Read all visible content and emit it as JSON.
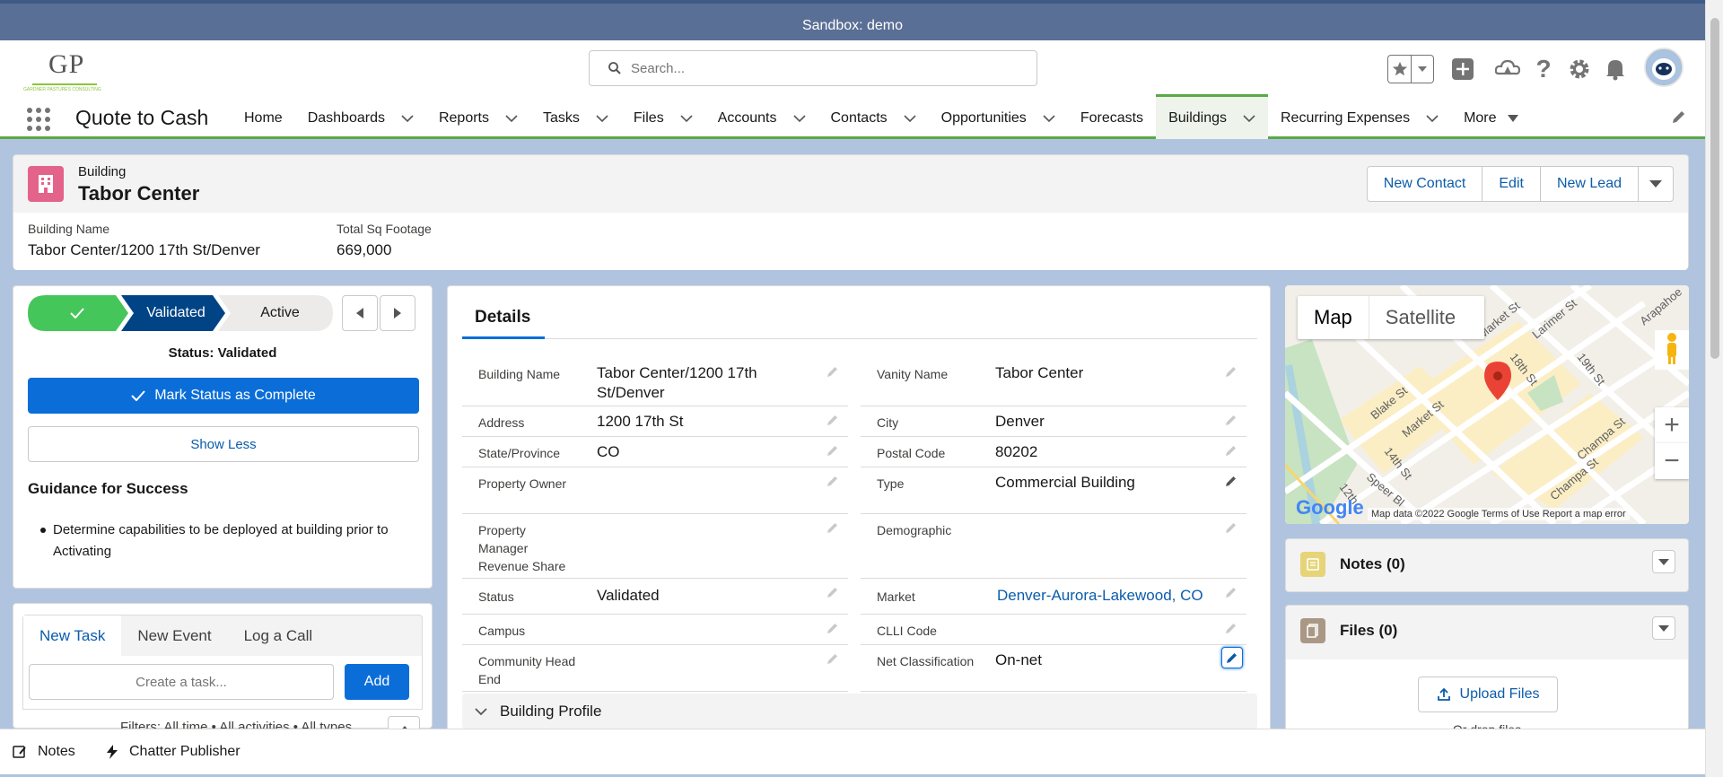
{
  "sandbox": {
    "label": "Sandbox: demo"
  },
  "logo": {
    "letters": "GP",
    "tagline": "GARDNER PASTURES CONSULTING"
  },
  "search": {
    "placeholder": "Search..."
  },
  "app": {
    "name": "Quote to Cash"
  },
  "nav": {
    "items": [
      {
        "label": "Home",
        "has_menu": false
      },
      {
        "label": "Dashboards",
        "has_menu": true
      },
      {
        "label": "Reports",
        "has_menu": true
      },
      {
        "label": "Tasks",
        "has_menu": true
      },
      {
        "label": "Files",
        "has_menu": true
      },
      {
        "label": "Accounts",
        "has_menu": true
      },
      {
        "label": "Contacts",
        "has_menu": true
      },
      {
        "label": "Opportunities",
        "has_menu": true
      },
      {
        "label": "Forecasts",
        "has_menu": false
      },
      {
        "label": "Buildings",
        "has_menu": true,
        "active": true
      },
      {
        "label": "Recurring Expenses",
        "has_menu": true
      },
      {
        "label": "More",
        "has_menu": true
      }
    ]
  },
  "record": {
    "type": "Building",
    "title": "Tabor Center",
    "actions": {
      "new_contact": "New Contact",
      "edit": "Edit",
      "new_lead": "New Lead"
    },
    "highlights": [
      {
        "label": "Building Name",
        "value": "Tabor Center/1200 17th St/Denver"
      },
      {
        "label": "Total Sq Footage",
        "value": "669,000"
      }
    ]
  },
  "path": {
    "steps": [
      "Validated",
      "Active"
    ],
    "status_text": "Status: Validated",
    "mark_complete": "Mark Status as Complete",
    "show_less": "Show Less",
    "guidance_title": "Guidance for Success",
    "guidance_items": [
      "Determine capabilities to be deployed at building prior to Activating"
    ]
  },
  "activity": {
    "tabs": [
      "New Task",
      "New Event",
      "Log a Call"
    ],
    "task_placeholder": "Create a task...",
    "add_label": "Add",
    "filters": "Filters: All time • All activities • All types"
  },
  "details": {
    "tab": "Details",
    "left": [
      {
        "label": "Building Name",
        "value": "Tabor Center/1200 17th St/Denver"
      },
      {
        "label": "Address",
        "value": "1200 17th St"
      },
      {
        "label": "State/Province",
        "value": "CO"
      },
      {
        "label": "Property Owner",
        "value": ""
      },
      {
        "label": "Property Manager Revenue Share",
        "value": ""
      },
      {
        "label": "Status",
        "value": "Validated"
      },
      {
        "label": "Campus",
        "value": ""
      },
      {
        "label": "Community Head End",
        "value": ""
      }
    ],
    "right": [
      {
        "label": "Vanity Name",
        "value": "Tabor Center"
      },
      {
        "label": "City",
        "value": "Denver"
      },
      {
        "label": "Postal Code",
        "value": "80202"
      },
      {
        "label": "Type",
        "value": "Commercial Building"
      },
      {
        "label": "Demographic",
        "value": ""
      },
      {
        "label": "Market",
        "value": "Denver-Aurora-Lakewood, CO"
      },
      {
        "label": "CLLI Code",
        "value": ""
      },
      {
        "label": "Net Classification",
        "value": "On-net"
      }
    ],
    "section": "Building Profile"
  },
  "map": {
    "map_label": "Map",
    "satellite_label": "Satellite",
    "footer": "Map data ©2022 Google   Terms of Use   Report a map error",
    "streets": [
      "Market St",
      "Larimer St",
      "19th St",
      "Arapahoe",
      "18th St",
      "Blake St",
      "Market St",
      "14th St",
      "Speer Bl",
      "Champa St",
      "Champa St",
      "12th"
    ],
    "brand": "Google"
  },
  "related": {
    "notes": "Notes (0)",
    "files": "Files (0)",
    "upload": "Upload Files",
    "drop": "Or drop files"
  },
  "utility": {
    "notes": "Notes",
    "chatter": "Chatter Publisher"
  }
}
